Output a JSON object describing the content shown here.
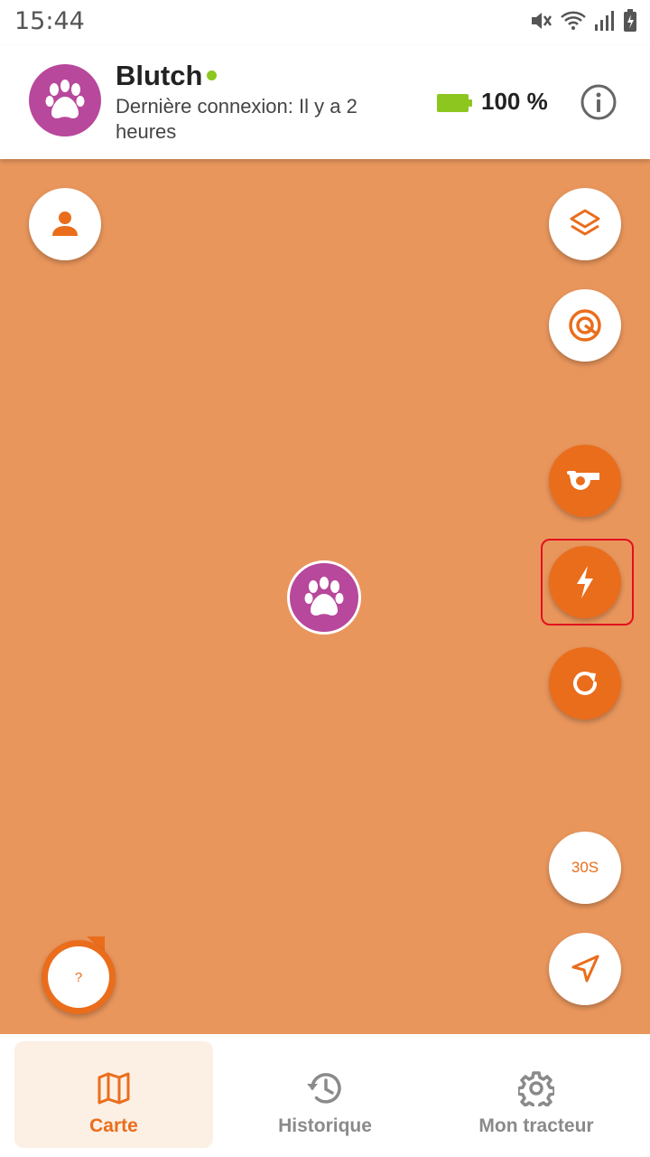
{
  "status_bar": {
    "time": "15:44"
  },
  "header": {
    "pet_name": "Blutch",
    "last_seen": "Dernière connexion: Il y a 2 heures",
    "battery_text": "100 %",
    "battery_level": 1.0
  },
  "map": {
    "refresh_interval_label": "30S",
    "help_label": "?"
  },
  "bottom_nav": {
    "items": [
      {
        "label": "Carte",
        "icon": "map-icon",
        "active": true
      },
      {
        "label": "Historique",
        "icon": "history-icon",
        "active": false
      },
      {
        "label": "Mon tracteur",
        "icon": "gear-icon",
        "active": false
      }
    ]
  },
  "colors": {
    "accent": "#ea6d1c",
    "map_background": "#e9965c",
    "avatar": "#b8489c",
    "online": "#8cc61e",
    "highlight": "#e3101d"
  }
}
